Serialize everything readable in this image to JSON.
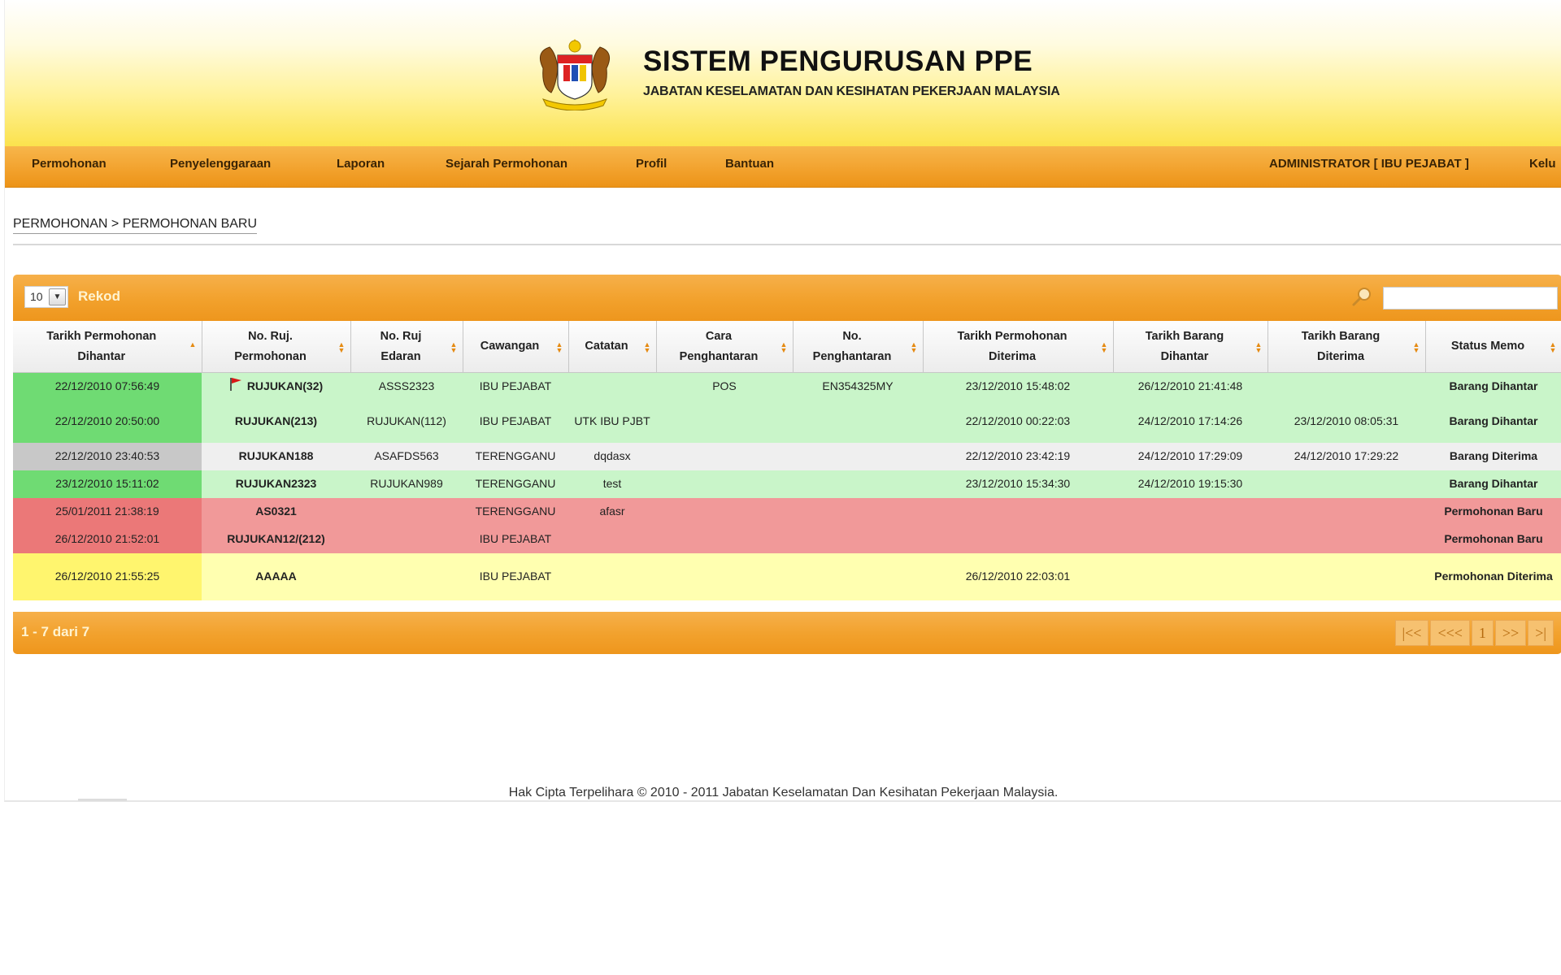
{
  "header": {
    "title": "SISTEM PENGURUSAN PPE",
    "subtitle": "JABATAN KESELAMATAN DAN KESIHATAN PEKERJAAN MALAYSIA"
  },
  "nav": {
    "items": [
      "Permohonan",
      "Penyelenggaraan",
      "Laporan",
      "Sejarah Permohonan",
      "Profil",
      "Bantuan"
    ],
    "user": "ADMINISTRATOR [ IBU PEJABAT ]",
    "logout": "Kelu"
  },
  "breadcrumb": "PERMOHONAN > PERMOHONAN BARU",
  "grid": {
    "rows_per_page": "10",
    "rows_label": "Rekod",
    "search_value": "",
    "columns": [
      [
        "Tarikh Permohonan",
        "Dihantar"
      ],
      [
        "No. Ruj.",
        "Permohonan"
      ],
      [
        "No. Ruj",
        "Edaran"
      ],
      [
        "Cawangan",
        ""
      ],
      [
        "Catatan",
        ""
      ],
      [
        "Cara",
        "Penghantaran"
      ],
      [
        "No.",
        "Penghantaran"
      ],
      [
        "Tarikh Permohonan",
        "Diterima"
      ],
      [
        "Tarikh Barang",
        "Dihantar"
      ],
      [
        "Tarikh Barang",
        "Diterima"
      ],
      [
        "Status Memo",
        ""
      ]
    ],
    "rows": [
      {
        "status_color": "green",
        "flag": true,
        "cells": [
          "22/12/2010 07:56:49",
          "RUJUKAN(32)",
          "ASSS2323",
          "IBU PEJABAT",
          "",
          "POS",
          "EN354325MY",
          "23/12/2010 15:48:02",
          "26/12/2010 21:41:48",
          "",
          "Barang Dihantar"
        ]
      },
      {
        "status_color": "green",
        "flag": false,
        "cells": [
          "22/12/2010 20:50:00",
          "RUJUKAN(213)",
          "RUJUKAN(112)",
          "IBU PEJABAT",
          "UTK IBU PJBT",
          "",
          "",
          "22/12/2010 00:22:03",
          "24/12/2010 17:14:26",
          "23/12/2010 08:05:31",
          "Barang Dihantar"
        ]
      },
      {
        "status_color": "gray",
        "flag": false,
        "cells": [
          "22/12/2010 23:40:53",
          "RUJUKAN188",
          "ASAFDS563",
          "TERENGGANU",
          "dqdasx",
          "",
          "",
          "22/12/2010 23:42:19",
          "24/12/2010 17:29:09",
          "24/12/2010 17:29:22",
          "Barang Diterima"
        ]
      },
      {
        "status_color": "green",
        "flag": false,
        "cells": [
          "23/12/2010 15:11:02",
          "RUJUKAN2323",
          "RUJUKAN989",
          "TERENGGANU",
          "test",
          "",
          "",
          "23/12/2010 15:34:30",
          "24/12/2010 19:15:30",
          "",
          "Barang Dihantar"
        ]
      },
      {
        "status_color": "red",
        "flag": false,
        "cells": [
          "25/01/2011 21:38:19",
          "AS0321",
          "",
          "TERENGGANU",
          "afasr",
          "",
          "",
          "",
          "",
          "",
          "Permohonan Baru"
        ]
      },
      {
        "status_color": "red",
        "flag": false,
        "cells": [
          "26/12/2010 21:52:01",
          "RUJUKAN12/(212)",
          "",
          "IBU PEJABAT",
          "",
          "",
          "",
          "",
          "",
          "",
          "Permohonan Baru"
        ]
      },
      {
        "status_color": "yellow",
        "flag": false,
        "cells": [
          "26/12/2010 21:55:25",
          "AAAAA",
          "",
          "IBU PEJABAT",
          "",
          "",
          "",
          "26/12/2010 22:03:01",
          "",
          "",
          "Permohonan Diterima"
        ]
      }
    ],
    "paging_info": "1 - 7 dari 7",
    "pager": [
      "|<<",
      "<<<",
      "1",
      ">>",
      ">|"
    ]
  },
  "footer": {
    "copyright": "Hak Cipta Terpelihara © 2010 - 2011 Jabatan Keselamatan Dan Kesihatan Pekerjaan Malaysia."
  },
  "colors": {
    "nav_orange": "#f2a12c",
    "row_green": "#c9f5c9",
    "row_red": "#f19999",
    "row_yellow": "#ffffb0",
    "row_gray": "#efefef"
  }
}
